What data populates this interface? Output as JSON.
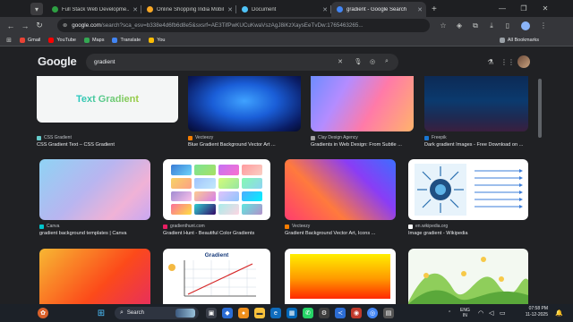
{
  "browser": {
    "tabs": [
      {
        "title": "Full Stack Web Developme...",
        "favicon_color": "#2ea043",
        "active": false
      },
      {
        "title": "Online Shopping India Mobile...",
        "favicon_color": "#f9a825",
        "active": false
      },
      {
        "title": "Document",
        "favicon_color": "#4fc3f7",
        "active": false
      },
      {
        "title": "gradient - Google Search",
        "favicon_color": "#4285f4",
        "active": true
      }
    ],
    "new_tab": "+",
    "address_host": "google.com",
    "address_path": "/search?sca_esv=b338e4d6fb6d8e5&sxsrf=AE3TifPwKUCuKwaVszAgJ8iKzXaysEeTvDw:1765463265...",
    "bookmarks": [
      {
        "label": "Gmail",
        "color": "#ea4335"
      },
      {
        "label": "YouTube",
        "color": "#ff0000"
      },
      {
        "label": "Maps",
        "color": "#34a853"
      },
      {
        "label": "Translate",
        "color": "#4285f4"
      },
      {
        "label": "You",
        "color": "#fbbc04"
      }
    ],
    "all_bookmarks": "All Bookmarks"
  },
  "google": {
    "logo": "Google",
    "query": "gradient"
  },
  "results": [
    {
      "source": "CSS Gradient",
      "title": "CSS Gradient Text – CSS Gradient",
      "icon_color": "#6cc",
      "thumb_text": "Text Gradient"
    },
    {
      "source": "Vecteezy",
      "title": "Blue Gradient Background Vector Art ...",
      "icon_color": "#f57c00",
      "thumb_text": ""
    },
    {
      "source": "Clay Design Agency",
      "title": "Gradients in Web Design: From Subtle ...",
      "icon_color": "#9e9e9e",
      "thumb_text": ""
    },
    {
      "source": "Freepik",
      "title": "Dark gradient Images - Free Download on ...",
      "icon_color": "#1976d2",
      "thumb_text": ""
    },
    {
      "source": "Canva",
      "title": "gradient background templates | Canva",
      "icon_color": "#00c4cc",
      "thumb_text": ""
    },
    {
      "source": "gradienthunt.com",
      "title": "Gradient Hunt - Beautiful Color Gradients",
      "icon_color": "#e91e63",
      "thumb_text": ""
    },
    {
      "source": "Vecteezy",
      "title": "Gradient Background Vector Art, Icons ...",
      "icon_color": "#f57c00",
      "thumb_text": ""
    },
    {
      "source": "en.wikipedia.org",
      "title": "Image gradient - Wikipedia",
      "icon_color": "#ffffff",
      "thumb_text": ""
    },
    {
      "source": "",
      "title": "",
      "icon_color": "",
      "thumb_text": ""
    },
    {
      "source": "",
      "title": "",
      "icon_color": "",
      "thumb_text": "Gradient"
    },
    {
      "source": "",
      "title": "",
      "icon_color": "",
      "thumb_text": ""
    },
    {
      "source": "",
      "title": "",
      "icon_color": "",
      "thumb_text": ""
    }
  ],
  "taskbar": {
    "search_label": "Search",
    "lang_top": "ENG",
    "lang_bottom": "IN",
    "time": "07:58 PM",
    "date": "11-12-2025"
  }
}
